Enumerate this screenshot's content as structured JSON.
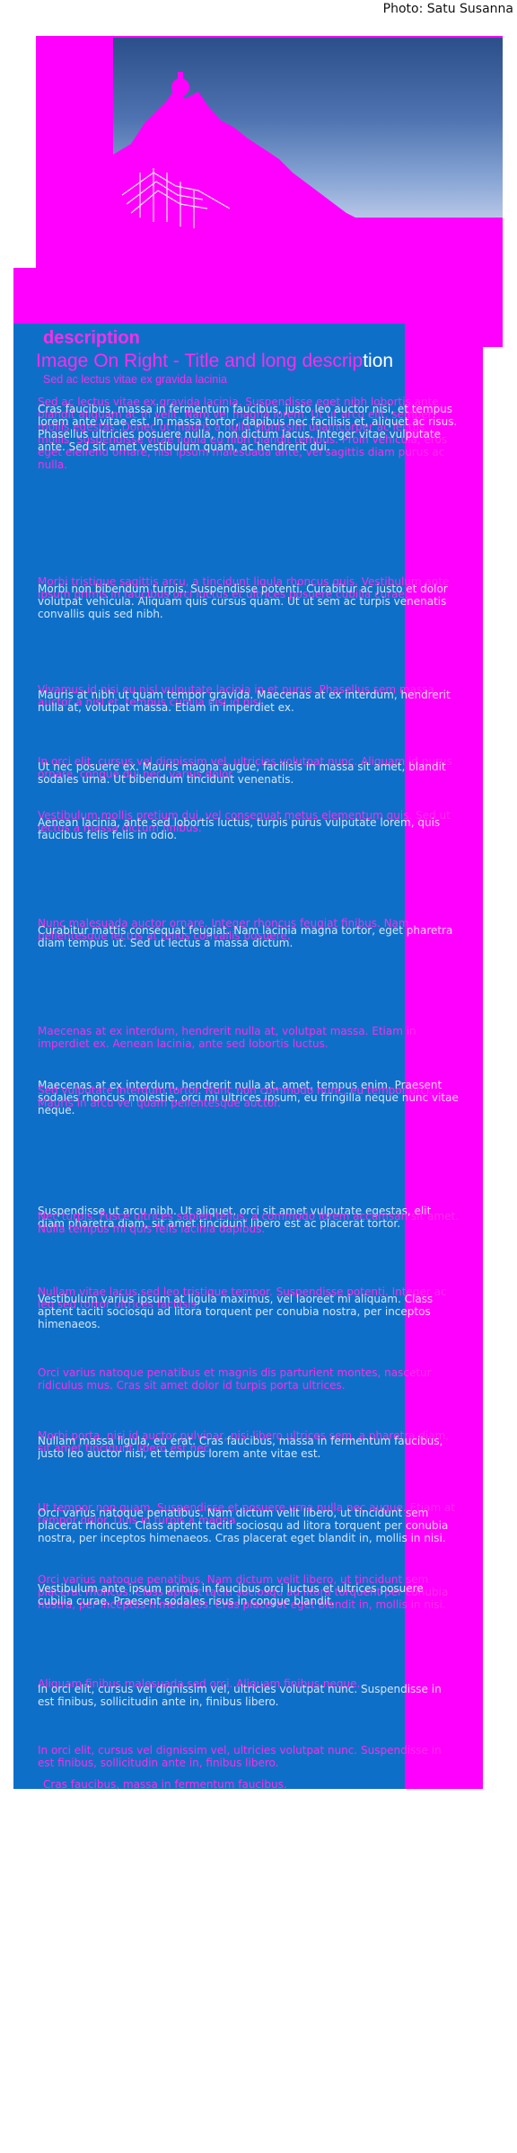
{
  "credit": "Photo: Satu Susanna",
  "description_label": "description",
  "title_highlight": "Image On Right - Title and long descrip",
  "title_rest": "tion",
  "subtitle": "Sed ac lectus vitae ex gravida lacinia",
  "paragraphs": [
    "Sed ac lectus vitae ex gravida lacinia. Suspendisse eget nibh lobortis ante blandit aliquam ac in velit. Nam vel magna lorem. Ut ut arcu elit, semper mollis egestas. Donec ut mauris a nulla dignissim ullamcorper ac lectus mollis. Suspendisse vitae ligula eu nibh blandit tempus. Proin vehicula, eros eget eleifend ornare, nisi ipsum malesuada ante, vel sagittis diam purus ac nulla.",
    "Morbi tristique sagittis arcu, a tincidunt ligula rhoncus quis. Vestibulum ante ipsum primis in faucibus orci luctus et ultrices posuere cubilia curae.",
    "Cras faucibus, massa in fermentum faucibus, justo leo auctor nisi, et tempus lorem ante vitae est. In massa tortor, dapibus nec facilisis et, aliquet ac risus. Phasellus ultricies posuere nulla, non dictum lacus. Integer vitae vulputate ante. Sed sit amet vestibulum quam, ac hendrerit dui.",
    "Vivamus id nisi eu nisl vulputate lacinia in et purus. Phasellus sem massa, auctor a nisl et, tempus cubilia nisi id nisi.",
    "In orci elit, cursus vel dignissim vel, ultricies volutpat nunc. Aliquam id purus ornare, congue dui nec, varius dolor.",
    "Ut nec posuere ex. Mauris magna augue, facilisis in massa sit amet, blandit sodales urna. Ut bibendum tincidunt venenatis.",
    "Morbi non bibendum turpis. Suspendisse potenti. Curabitur ac justo et dolor volutpat vehicula. Aliquam quis cursus quam. Ut ut sem ac turpis venenatis convallis quis sed nibh.",
    "Vestibulum mollis pretium dui, vel consequat metus elementum quis. Sed ut lectus a massa dictum finibus.",
    "Mauris at nibh ut quam tempor gravida. Maecenas at ex interdum, hendrerit nulla at, volutpat massa. Etiam in imperdiet ex.",
    "Aenean lacinia, ante sed lobortis luctus, turpis purus vulputate lorem, quis faucibus felis felis in odio.",
    "Nunc malesuada auctor ornare. Integer rhoncus feugiat finibus. Nam pellentesque lectus at tellus convallis posuere.",
    "Maecenas at ex interdum, hendrerit nulla at, volutpat massa. Etiam in imperdiet ex. Aenean lacinia, ante sed lobortis luctus.",
    "Curabitur mattis consequat feugiat. Nam lacinia magna tortor, eget pharetra diam tempus ut. Sed ut lectus a massa dictum.",
    "Maecenas at ex interdum, hendrerit nulla at, amet, tempus enim. Praesent sodales rhoncus molestie, orci mi ultrices ipsum, eu fringilla neque nunc vitae neque.",
    "Sed vulputate interdum tortor. Nunc non commodo nunc, eu tempor orci. Mauris in arcu vel quam pellentesque auctor.",
    "Suspendisse ut arcu nibh. Ut aliquet, orci sit amet vulputate egestas, elit diam pharetra diam, sit amet tincidunt libero est ac placerat tortor.",
    "Nec turpis. Fusce ultrices sapien tellus, a commodo lorem accumsan sit amet. Nulla tempus mi quis felis lacinia dapibus.",
    "Nullam vitae lacus sed leo tristique tempor. Suspendisse potenti. Integer ac leo sed tortor ultrices facilisis.",
    "Vestibulum varius ipsum at ligula maximus, vel laoreet mi aliquam. Class aptent taciti sociosqu ad litora torquent per conubia nostra, per inceptos himenaeos.",
    "Orci varius natoque penatibus et magnis dis parturient montes, nascetur ridiculus mus. Cras sit amet dolor id turpis porta ultrices.",
    "Morbi porta, nisi id auctor pulvinar, nisi libero ultrices sem, a pharetra diam, sit amet tincidunt libero est nec.",
    "Nullam massa ligula, eu erat. Cras faucibus, massa in fermentum faucibus, justo leo auctor nisi, et tempus lorem ante vitae est.",
    "Ut tempor non quam. Suspendisse et posuere urna nulla nec augue. Etiam at tempor dolor. Duis in turpis a magna.",
    "Orci varius natoque penatibus. Nam dictum velit libero, ut tincidunt sem placerat rhoncus. Class aptent taciti sociosqu ad litora torquent per conubia nostra, per inceptos himenaeos. Cras placerat eget blandit in, mollis in nisi.",
    "Vestibulum ante ipsum primis in faucibus orci luctus et ultrices posuere cubilia curae. Praesent sodales risus in congue blandit.",
    "Aliquam finibus malesuada sed orci. Aliquam finibus neque.",
    "In orci elit, cursus vel dignissim vel, ultricies volutpat nunc. Suspendisse in est finibus, sollicitudin ante in, finibus libero.",
    "Cras faucibus, massa in fermentum faucibus."
  ]
}
